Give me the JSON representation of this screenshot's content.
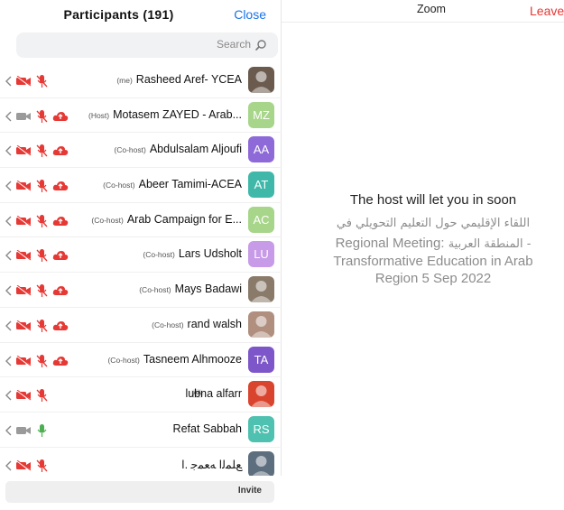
{
  "panel": {
    "title": "Participants (191)",
    "close_label": "Close",
    "search_placeholder": "Search",
    "invite_label": "Invite"
  },
  "participants": [
    {
      "name": "Rasheed Aref- YCEA",
      "role": "(me)",
      "initials": "",
      "avatar_color": "#6b5a4e",
      "cloud": false,
      "video": "off",
      "mic": "off"
    },
    {
      "name": "Motasem ZAYED - Arab...",
      "role": "(Host)",
      "initials": "MZ",
      "avatar_color": "#a7d58a",
      "cloud": true,
      "video": "on",
      "mic": "off"
    },
    {
      "name": "Abdulsalam Aljoufi",
      "role": "(Co-host)",
      "initials": "AA",
      "avatar_color": "#8e6ad9",
      "cloud": true,
      "video": "off",
      "mic": "off"
    },
    {
      "name": "Abeer Tamimi-ACEA",
      "role": "(Co-host)",
      "initials": "AT",
      "avatar_color": "#3fb8a9",
      "cloud": true,
      "video": "off",
      "mic": "off"
    },
    {
      "name": "Arab Campaign for E...",
      "role": "(Co-host)",
      "initials": "AC",
      "avatar_color": "#a7d58a",
      "cloud": true,
      "video": "off",
      "mic": "off"
    },
    {
      "name": "Lars Udsholt",
      "role": "(Co-host)",
      "initials": "LU",
      "avatar_color": "#c79be8",
      "cloud": true,
      "video": "off",
      "mic": "off"
    },
    {
      "name": "Mays Badawi",
      "role": "(Co-host)",
      "initials": "",
      "avatar_color": "#8a7a6a",
      "cloud": true,
      "video": "off",
      "mic": "off"
    },
    {
      "name": "rand walsh",
      "role": "(Co-host)",
      "initials": "",
      "avatar_color": "#b08f7f",
      "cloud": true,
      "video": "off",
      "mic": "off"
    },
    {
      "name": "Tasneem Alhmooze",
      "role": "(Co-host)",
      "initials": "TA",
      "avatar_color": "#7d57c9",
      "cloud": true,
      "video": "off",
      "mic": "off"
    },
    {
      "name": "lubna alfarr",
      "role": "",
      "initials": "",
      "avatar_color": "#d9442e",
      "cloud": false,
      "video": "off",
      "mic": "off",
      "badge": "AA"
    },
    {
      "name": "Refat Sabbah",
      "role": "",
      "initials": "RS",
      "avatar_color": "#4fc1b0",
      "cloud": false,
      "video": "on",
      "mic": "on"
    },
    {
      "name": "ﻊﻠﻤﻟﺍ ﻪﻌﻤﺟ .ﺍ",
      "role": "",
      "initials": "",
      "avatar_color": "#5d6e7e",
      "cloud": false,
      "video": "off",
      "mic": "off"
    }
  ],
  "main": {
    "app_title": "Zoom",
    "leave_label": "Leave",
    "wait_message": "The host will let you in soon",
    "meeting_arabic_1": "اللقاء الإقليمي حول التعليم التحويلي في",
    "meeting_line_2_ar": "المنطقة العربية -",
    "meeting_line_2_en": "Regional Meeting:",
    "meeting_line_3": "Transformative Education in Arab",
    "meeting_line_4": "Region 5 Sep 2022"
  },
  "colors": {
    "accent": "#1a73e8",
    "leave": "#e53935",
    "muted_icon": "#e53935",
    "unmuted_mic": "#4caf50"
  }
}
